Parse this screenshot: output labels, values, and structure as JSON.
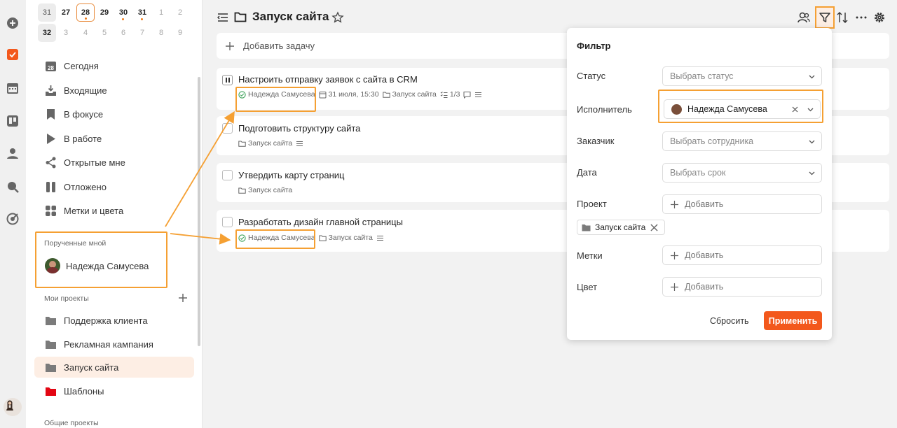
{
  "calendar": {
    "row1": [
      "31",
      "27",
      "28",
      "29",
      "30",
      "31",
      "1",
      "2"
    ],
    "row2": [
      "32",
      "3",
      "4",
      "5",
      "6",
      "7",
      "8",
      "9"
    ]
  },
  "sidebar": {
    "items": [
      {
        "label": "Сегодня",
        "icon": "calendar-icon"
      },
      {
        "label": "Входящие",
        "icon": "inbox-icon"
      },
      {
        "label": "В фокусе",
        "icon": "bookmark-icon"
      },
      {
        "label": "В работе",
        "icon": "play-icon"
      },
      {
        "label": "Открытые мне",
        "icon": "share-icon"
      },
      {
        "label": "Отложено",
        "icon": "pause-icon"
      },
      {
        "label": "Метки и цвета",
        "icon": "grid-icon"
      }
    ],
    "today_num": "28",
    "assigned_label": "Порученные мной",
    "assigned_user": "Надежда Самусева",
    "my_projects_label": "Мои проекты",
    "projects": [
      {
        "label": "Поддержка клиента",
        "color": "#7b7b7b"
      },
      {
        "label": "Рекламная кампания",
        "color": "#7b7b7b"
      },
      {
        "label": "Запуск сайта",
        "color": "#7b7b7b",
        "active": true
      },
      {
        "label": "Шаблоны",
        "color": "#e30613"
      }
    ],
    "shared_projects_label": "Общие проекты"
  },
  "header": {
    "title": "Запуск сайта"
  },
  "add_task_label": "Добавить задачу",
  "tasks": [
    {
      "title": "Настроить отправку заявок с сайта в CRM",
      "assignee": "Надежда Самусева",
      "date": "31 июля, 15:30",
      "project": "Запуск сайта",
      "checklist": "1/3"
    },
    {
      "title": "Подготовить структуру сайта",
      "project": "Запуск сайта"
    },
    {
      "title": "Утвердить карту страниц",
      "project": "Запуск сайта"
    },
    {
      "title": "Разработать дизайн главной страницы",
      "assignee": "Надежда Самусева",
      "project": "Запуск сайта"
    }
  ],
  "filter": {
    "title": "Фильтр",
    "status_label": "Статус",
    "status_placeholder": "Выбрать статус",
    "assignee_label": "Исполнитель",
    "assignee_value": "Надежда Самусева",
    "customer_label": "Заказчик",
    "customer_placeholder": "Выбрать сотрудника",
    "date_label": "Дата",
    "date_placeholder": "Выбрать срок",
    "project_label": "Проект",
    "add_label": "Добавить",
    "project_chip": "Запуск сайта",
    "tags_label": "Метки",
    "color_label": "Цвет",
    "reset_label": "Сбросить",
    "apply_label": "Применить"
  },
  "colors": {
    "accent": "#f3581c",
    "highlight": "#f5a033",
    "shablony": "#e30613"
  }
}
